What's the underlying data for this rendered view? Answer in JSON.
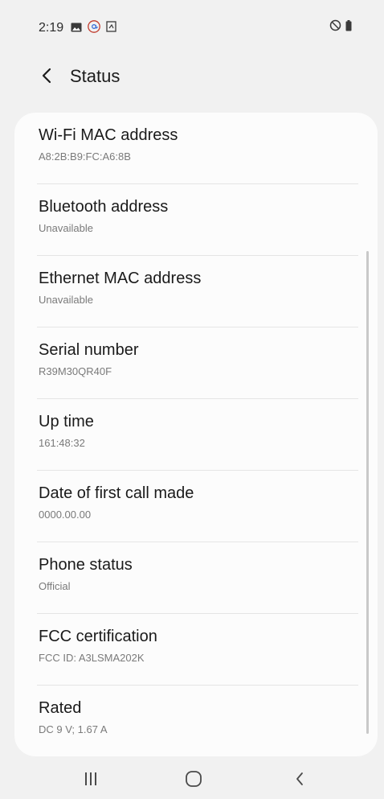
{
  "status_bar": {
    "time": "2:19",
    "left_icons": [
      "gallery-icon",
      "at-sign-icon",
      "screenshot-icon"
    ],
    "right_icons": [
      "do-not-disturb-icon",
      "battery-icon"
    ]
  },
  "header": {
    "back_icon": "chevron-left-icon",
    "title": "Status"
  },
  "items": [
    {
      "title": "Wi-Fi MAC address",
      "value": "A8:2B:B9:FC:A6:8B"
    },
    {
      "title": "Bluetooth address",
      "value": "Unavailable"
    },
    {
      "title": "Ethernet MAC address",
      "value": "Unavailable"
    },
    {
      "title": "Serial number",
      "value": "R39M30QR40F"
    },
    {
      "title": "Up time",
      "value": "161:48:32"
    },
    {
      "title": "Date of first call made",
      "value": "0000.00.00"
    },
    {
      "title": "Phone status",
      "value": "Official"
    },
    {
      "title": "FCC certification",
      "value": "FCC ID: A3LSMA202K"
    },
    {
      "title": "Rated",
      "value": "DC 9 V; 1.67 A"
    }
  ],
  "nav_bar": {
    "buttons": [
      "recent-apps-icon",
      "home-icon",
      "back-icon"
    ]
  },
  "colors": {
    "background": "#f1f1f1",
    "card": "#fcfcfc",
    "divider": "#e5e5e5",
    "title_text": "#1a1a1a",
    "subtitle_text": "#7a7a7a"
  }
}
